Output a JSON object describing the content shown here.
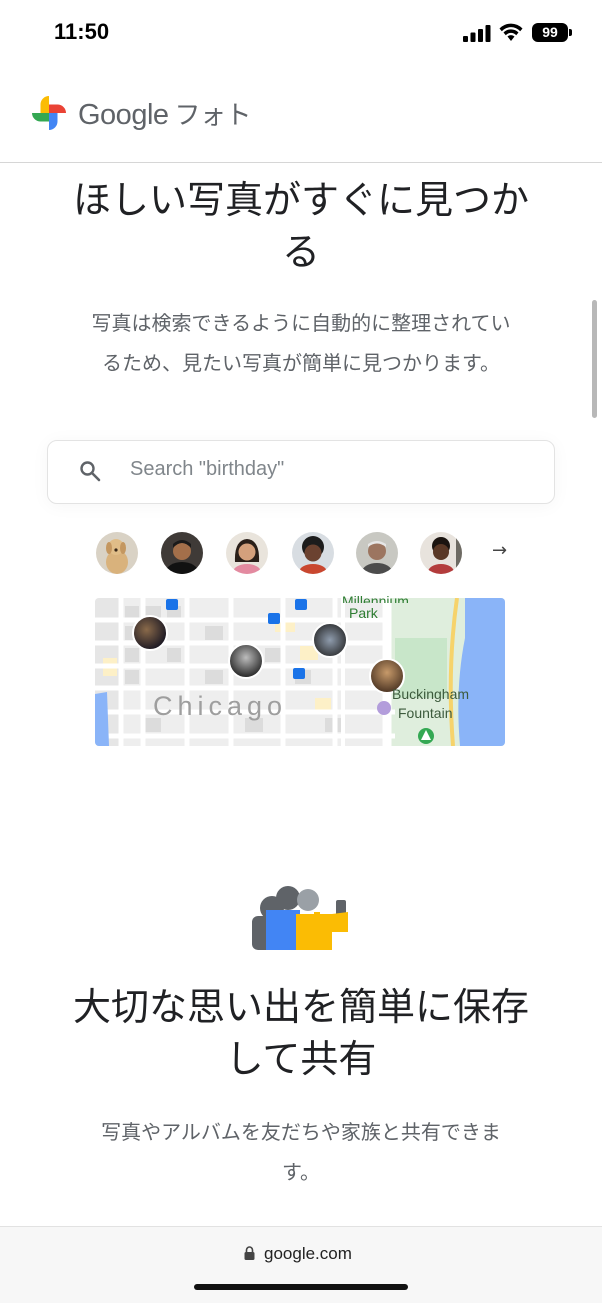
{
  "status_bar": {
    "time": "11:50",
    "battery": "99"
  },
  "header": {
    "brand": "Google",
    "brand_suffix": "フォト"
  },
  "section1": {
    "heading_line1": "ほしい写真がすぐに見つか",
    "heading_line2": "る",
    "desc_line1": "写真は検索できるように自動的に整理されてい",
    "desc_line2": "るため、見たい写真が簡単に見つかります。"
  },
  "search": {
    "placeholder": "Search \"birthday\""
  },
  "people_arrow": "→",
  "map": {
    "city": "Chicago",
    "park_label": "Park",
    "millennium_label": "Millennium",
    "fountain_line1": "Buckingham",
    "fountain_line2": "Fountain",
    "metro_icon": "M",
    "colors": {
      "water": "#8ab4f8",
      "park": "#c8e6c9",
      "road": "#ffffff",
      "land": "#eeeeee"
    }
  },
  "section2": {
    "heading_line1": "大切な思い出を簡単に保存",
    "heading_line2": "して共有",
    "desc_line1": "写真やアルバムを友だちや家族と共有できま",
    "desc_line2": "す。"
  },
  "browser": {
    "url": "google.com"
  },
  "colors": {
    "blue": "#4285f4",
    "red": "#ea4335",
    "yellow": "#fbbc04",
    "green": "#34a853",
    "text": "#202124",
    "muted": "#5f6368"
  }
}
